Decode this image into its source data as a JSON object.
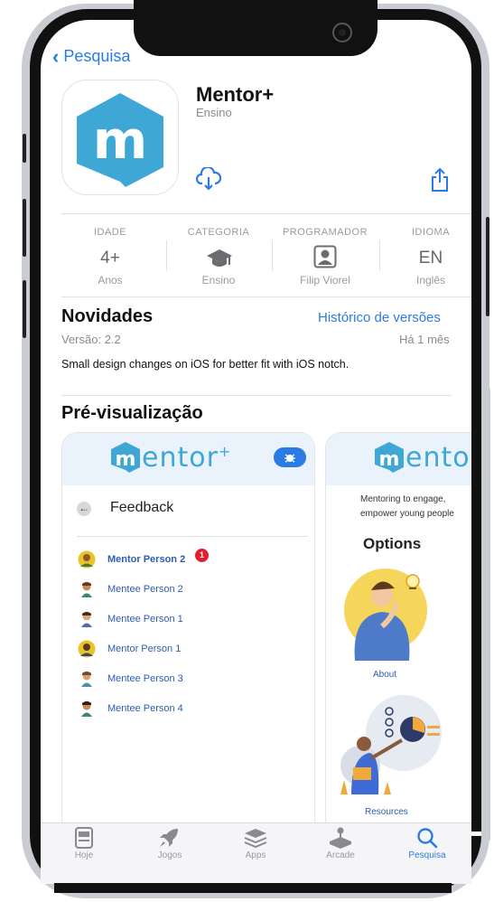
{
  "nav": {
    "back_label": "Pesquisa"
  },
  "app": {
    "name": "Mentor+",
    "category": "Ensino"
  },
  "meta": [
    {
      "header": "IDADE",
      "value": "4+",
      "sub": "Anos"
    },
    {
      "header": "CATEGORIA",
      "value": "",
      "sub": "Ensino",
      "icon": "graduation-cap-icon"
    },
    {
      "header": "PROGRAMADOR",
      "value": "",
      "sub": "Filip Viorel",
      "icon": "person-icon"
    },
    {
      "header": "IDIOMA",
      "value": "EN",
      "sub": "Inglês"
    }
  ],
  "whats_new": {
    "title": "Novidades",
    "history_link": "Histórico de versões",
    "version": "Versão: 2.2",
    "age": "Há 1 mês",
    "notes": "Small design changes on iOS for better fit with iOS notch."
  },
  "preview": {
    "title": "Pré-visualização",
    "shot1": {
      "logo": "mentor",
      "logo_plus": "+",
      "header": "Feedback",
      "people": [
        {
          "name": "Mentor Person 2",
          "badge": "1",
          "bold": true
        },
        {
          "name": "Mentee Person 2"
        },
        {
          "name": "Mentee Person 1"
        },
        {
          "name": "Mentor Person 1"
        },
        {
          "name": "Mentee Person 3"
        },
        {
          "name": "Mentee Person 4"
        }
      ]
    },
    "shot2": {
      "logo": "mento",
      "tagline_1": "Mentoring to engage,",
      "tagline_2": "empower young people",
      "options_title": "Options",
      "about_label": "About",
      "resources_label": "Resources"
    }
  },
  "tabs": [
    {
      "label": "Hoje",
      "icon": "today-icon",
      "active": false
    },
    {
      "label": "Jogos",
      "icon": "rocket-icon",
      "active": false
    },
    {
      "label": "Apps",
      "icon": "apps-stack-icon",
      "active": false
    },
    {
      "label": "Arcade",
      "icon": "joystick-icon",
      "active": false
    },
    {
      "label": "Pesquisa",
      "icon": "search-icon",
      "active": true
    }
  ],
  "colors": {
    "accent": "#2a7be4",
    "logo_blue": "#3fa7d6",
    "badge_red": "#e0202d"
  }
}
